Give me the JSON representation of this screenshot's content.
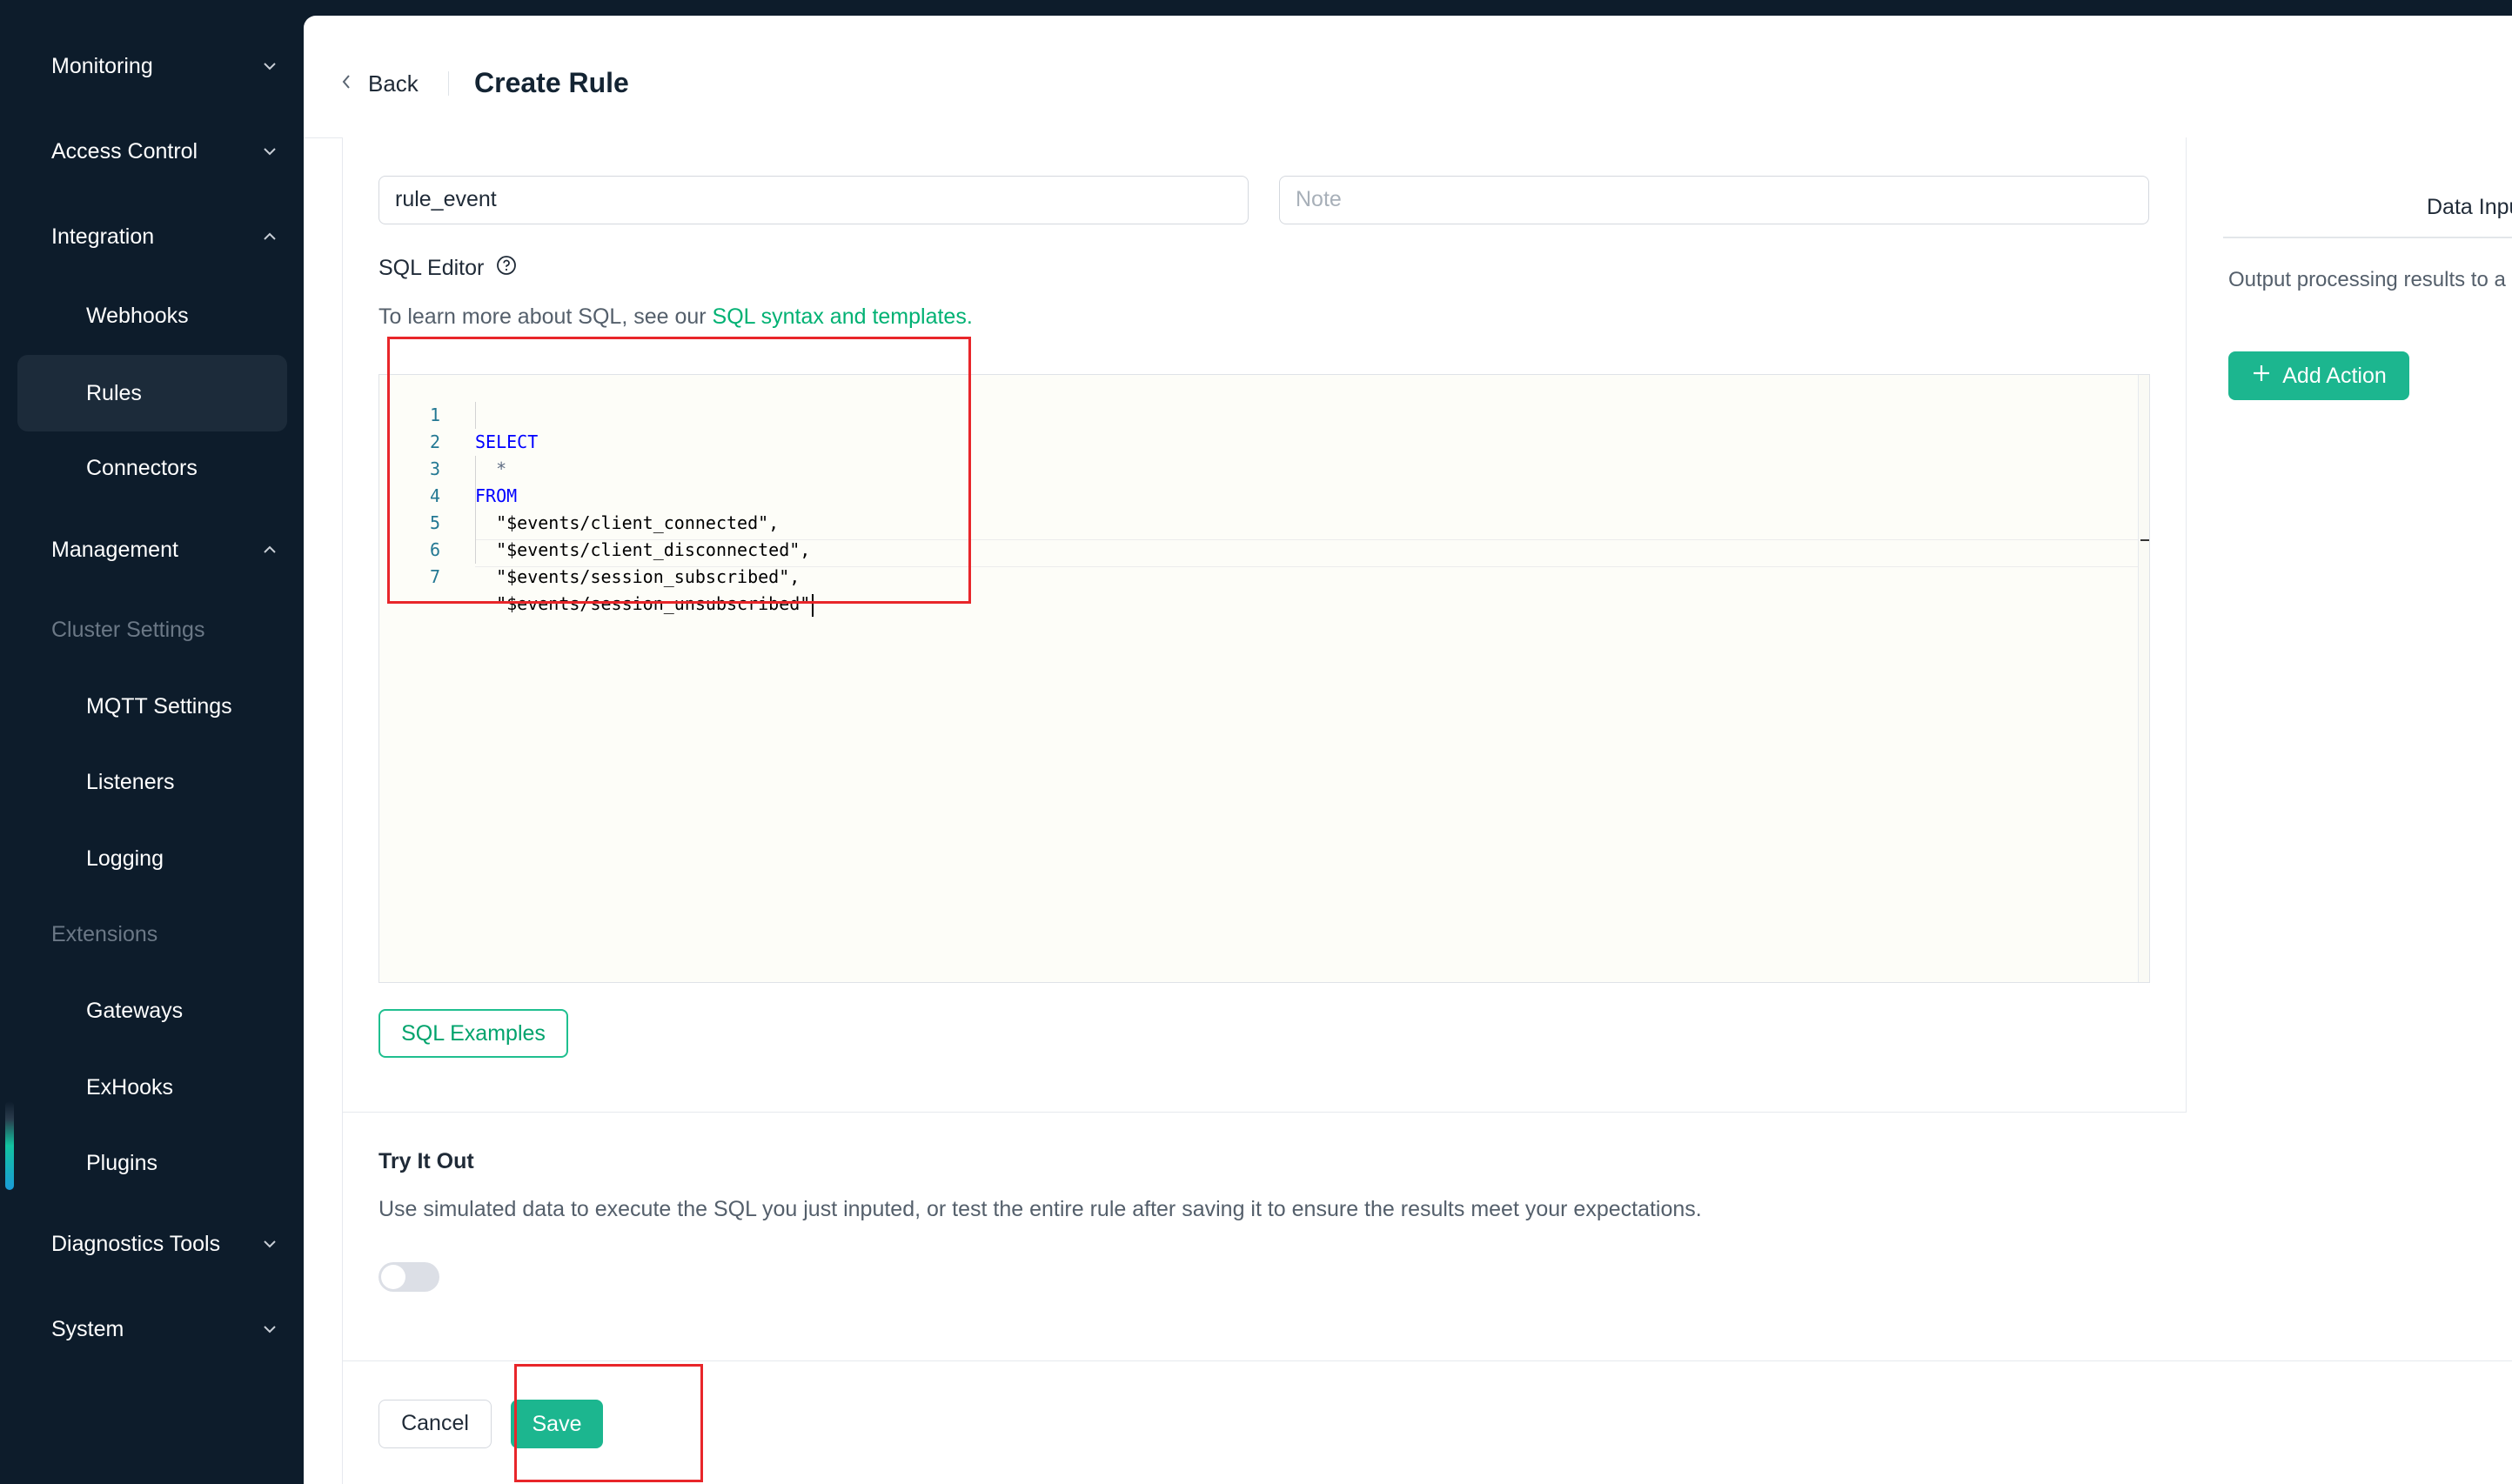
{
  "sidebar": {
    "items": [
      {
        "label": "Monitoring"
      },
      {
        "label": "Access Control"
      },
      {
        "label": "Integration"
      },
      {
        "label": "Webhooks"
      },
      {
        "label": "Rules"
      },
      {
        "label": "Connectors"
      },
      {
        "label": "Management"
      },
      {
        "label": "Cluster Settings"
      },
      {
        "label": "MQTT Settings"
      },
      {
        "label": "Listeners"
      },
      {
        "label": "Logging"
      },
      {
        "label": "Extensions"
      },
      {
        "label": "Gateways"
      },
      {
        "label": "ExHooks"
      },
      {
        "label": "Plugins"
      },
      {
        "label": "Diagnostics Tools"
      },
      {
        "label": "System"
      }
    ],
    "active": "Rules"
  },
  "header": {
    "back_label": "Back",
    "title": "Create Rule"
  },
  "form": {
    "name_value": "rule_event",
    "note_placeholder": "Note",
    "sql_editor_label": "SQL Editor",
    "help_prefix": "To learn more about SQL, see our ",
    "help_link": "SQL syntax and templates."
  },
  "editor": {
    "line_numbers": [
      "1",
      "2",
      "3",
      "4",
      "5",
      "6",
      "7"
    ],
    "lines": [
      "SELECT",
      "  *",
      "FROM",
      "  \"$events/client_connected\",",
      "  \"$events/client_disconnected\",",
      "  \"$events/session_subscribed\",",
      "  \"$events/session_unsubscribed\""
    ]
  },
  "sql_examples_label": "SQL Examples",
  "right_panel": {
    "tab_label": "Data Inputs",
    "description": "Output processing results to a",
    "add_action_label": "Add Action"
  },
  "try_it_out": {
    "title": "Try It Out",
    "description": "Use simulated data to execute the SQL you just inputed, or test the entire rule after saving it to ensure the results meet your expectations.",
    "enabled": false
  },
  "footer": {
    "cancel_label": "Cancel",
    "save_label": "Save"
  },
  "colors": {
    "sidebar_bg": "#0d1c2b",
    "accent": "#1cb68f",
    "link": "#00b173",
    "annotation": "#e8262a"
  }
}
